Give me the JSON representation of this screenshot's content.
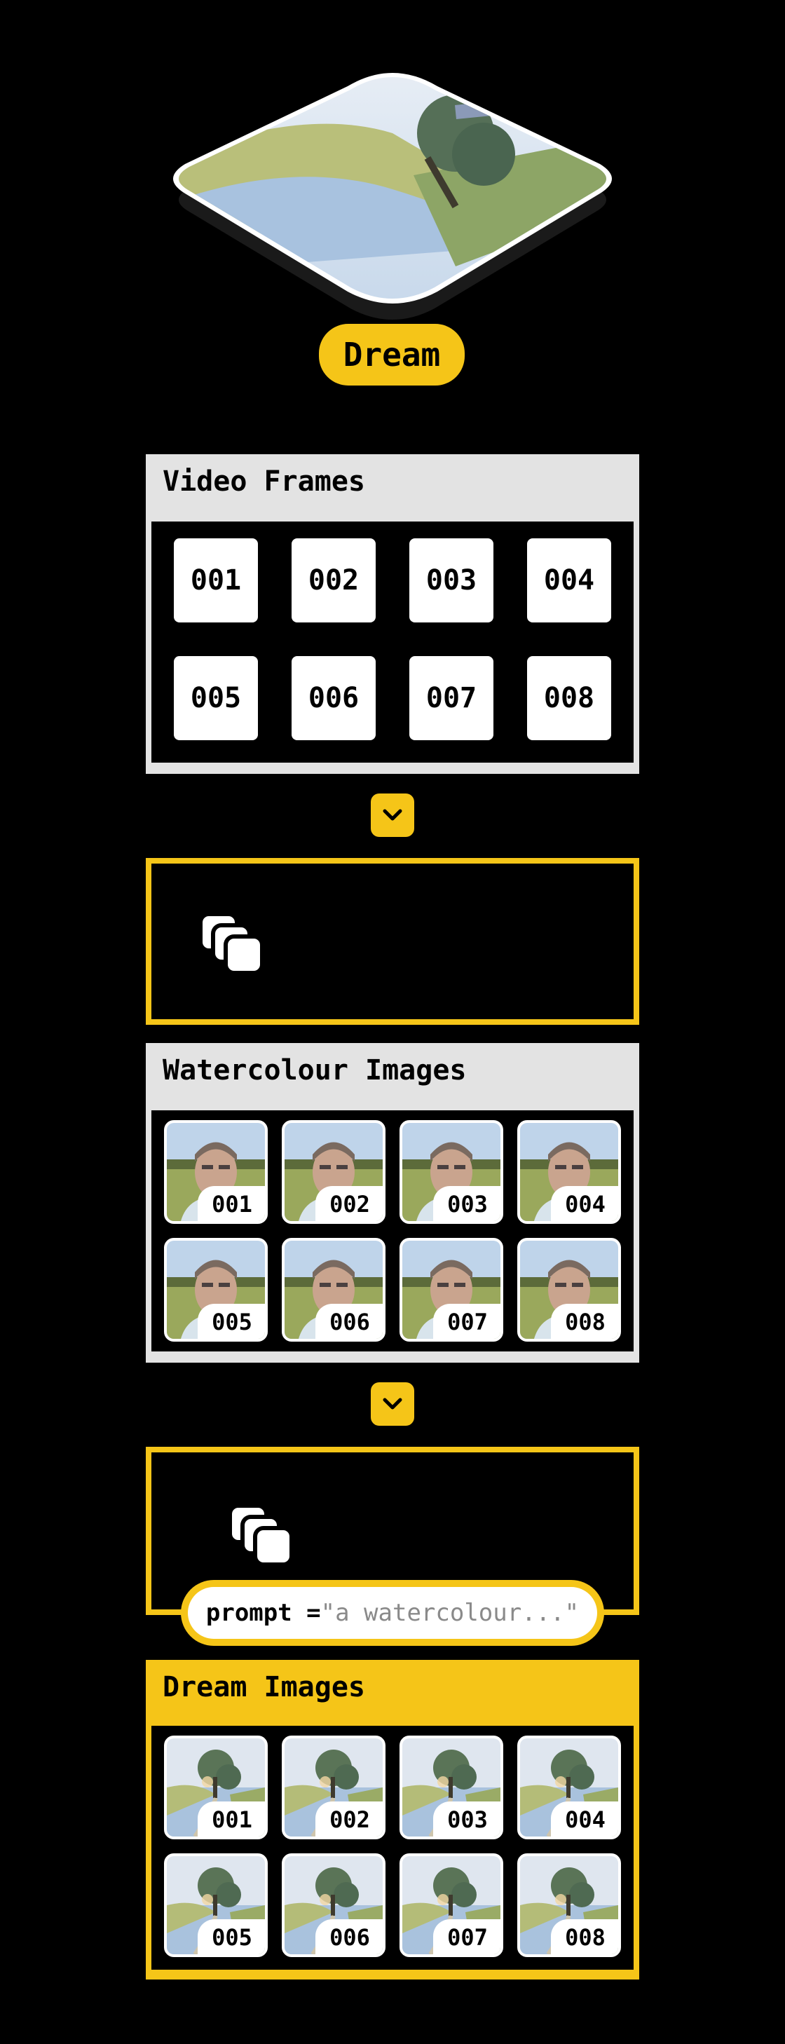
{
  "hero": {
    "label": "Dream"
  },
  "video_frames": {
    "title": "Video Frames",
    "frames": [
      "001",
      "002",
      "003",
      "004",
      "005",
      "006",
      "007",
      "008"
    ]
  },
  "watercolour_images": {
    "title": "Watercolour Images",
    "items": [
      "001",
      "002",
      "003",
      "004",
      "005",
      "006",
      "007",
      "008"
    ]
  },
  "process_step": {
    "prompt_key": "prompt = ",
    "prompt_value": "\"a watercolour...\""
  },
  "dream_images": {
    "title": "Dream Images",
    "items": [
      "001",
      "002",
      "003",
      "004",
      "005",
      "006",
      "007",
      "008"
    ]
  },
  "colors": {
    "accent": "#f5c518",
    "panel_gray": "#e3e3e3",
    "background": "#000000"
  },
  "icons": {
    "arrow": "chevron-down-icon",
    "step": "stacked-squares-icon"
  }
}
